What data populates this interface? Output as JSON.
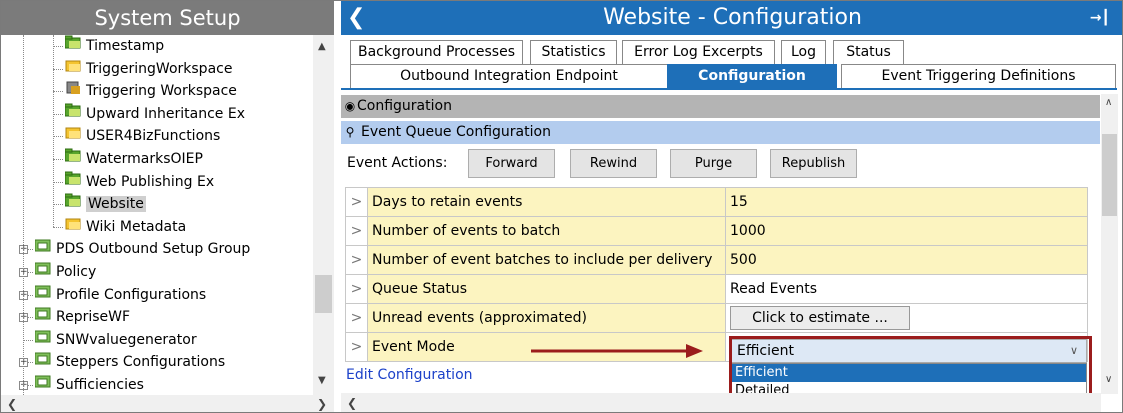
{
  "left_panel": {
    "title": "System Setup",
    "tree": [
      {
        "label": "Timestamp",
        "icon": "folder-green-icon"
      },
      {
        "label": "TriggeringWorkspace",
        "icon": "folder-yellow-icon"
      },
      {
        "label": "Triggering Workspace",
        "icon": "workspace-icon"
      },
      {
        "label": "Upward Inheritance Ex",
        "icon": "folder-green-icon"
      },
      {
        "label": "USER4BizFunctions",
        "icon": "folder-yellow-icon"
      },
      {
        "label": "WatermarksOIEP",
        "icon": "folder-green-icon"
      },
      {
        "label": "Web Publishing Ex",
        "icon": "folder-green-icon"
      },
      {
        "label": "Website",
        "icon": "folder-green-icon",
        "selected": true
      },
      {
        "label": "Wiki Metadata",
        "icon": "folder-yellow-icon"
      },
      {
        "label": "PDS Outbound Setup Group",
        "icon": "group-icon"
      },
      {
        "label": "Policy",
        "icon": "group-icon"
      },
      {
        "label": "Profile Configurations",
        "icon": "group-icon"
      },
      {
        "label": "RepriseWF",
        "icon": "group-icon"
      },
      {
        "label": "SNWvaluegenerator",
        "icon": "group-icon"
      },
      {
        "label": "Steppers Configurations",
        "icon": "group-icon"
      },
      {
        "label": "Sufficiencies",
        "icon": "group-icon"
      }
    ]
  },
  "right_panel": {
    "title": "Website - Configuration",
    "tabs_row1": [
      "Background Processes",
      "Statistics",
      "Error Log Excerpts",
      "Log",
      "Status"
    ],
    "tabs_row2": [
      "Outbound Integration Endpoint",
      "Configuration",
      "Event Triggering Definitions"
    ],
    "active_tab": "Configuration",
    "section_configuration": "Configuration",
    "section_event_queue": "Event Queue Configuration",
    "event_actions_label": "Event Actions:",
    "buttons": [
      "Forward",
      "Rewind",
      "Purge",
      "Republish"
    ],
    "properties": [
      {
        "label": "Days to retain events",
        "value": "15"
      },
      {
        "label": "Number of events to batch",
        "value": "1000"
      },
      {
        "label": "Number of event batches to include per delivery",
        "value": "500"
      },
      {
        "label": "Queue Status",
        "value": "Read Events"
      },
      {
        "label": "Unread events (approximated)",
        "button": "Click to estimate ..."
      },
      {
        "label": "Event Mode",
        "value": "Efficient"
      }
    ],
    "edit_link": "Edit Configuration",
    "event_mode": {
      "selected": "Efficient",
      "options": [
        "Efficient",
        "Detailed"
      ],
      "highlighted": "Efficient"
    }
  },
  "colors": {
    "accent": "#1e6fb8",
    "left_title_bg": "#7b7b7b",
    "property_bg": "#fcf4c0",
    "annotation": "#9b1c1c"
  }
}
